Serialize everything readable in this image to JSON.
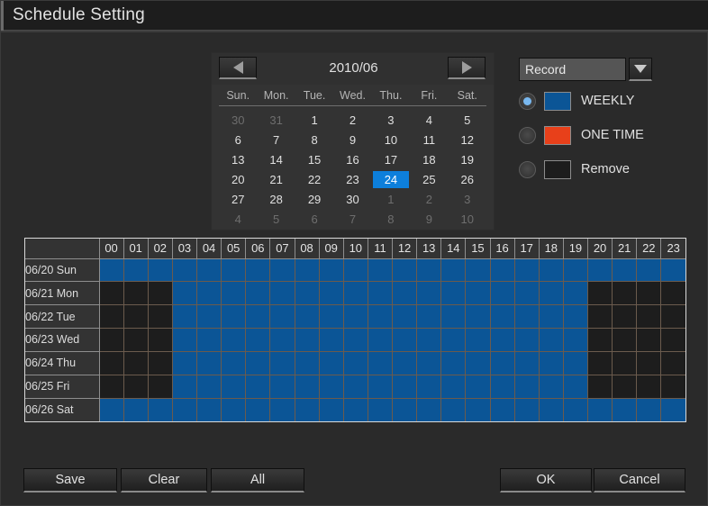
{
  "window": {
    "title": "Schedule Setting"
  },
  "calendar": {
    "prev_icon": "triangle-left-icon",
    "next_icon": "triangle-right-icon",
    "month_label": "2010/06",
    "day_headers": [
      "Sun.",
      "Mon.",
      "Tue.",
      "Wed.",
      "Thu.",
      "Fri.",
      "Sat."
    ],
    "selected_day": 24,
    "weeks": [
      [
        {
          "n": "30",
          "other": true
        },
        {
          "n": "31",
          "other": true
        },
        {
          "n": "1"
        },
        {
          "n": "2"
        },
        {
          "n": "3"
        },
        {
          "n": "4"
        },
        {
          "n": "5"
        }
      ],
      [
        {
          "n": "6"
        },
        {
          "n": "7"
        },
        {
          "n": "8"
        },
        {
          "n": "9"
        },
        {
          "n": "10"
        },
        {
          "n": "11"
        },
        {
          "n": "12"
        }
      ],
      [
        {
          "n": "13"
        },
        {
          "n": "14"
        },
        {
          "n": "15"
        },
        {
          "n": "16"
        },
        {
          "n": "17"
        },
        {
          "n": "18"
        },
        {
          "n": "19"
        }
      ],
      [
        {
          "n": "20"
        },
        {
          "n": "21"
        },
        {
          "n": "22"
        },
        {
          "n": "23"
        },
        {
          "n": "24",
          "selected": true
        },
        {
          "n": "25"
        },
        {
          "n": "26"
        }
      ],
      [
        {
          "n": "27"
        },
        {
          "n": "28"
        },
        {
          "n": "29"
        },
        {
          "n": "30"
        },
        {
          "n": "1",
          "other": true
        },
        {
          "n": "2",
          "other": true
        },
        {
          "n": "3",
          "other": true
        }
      ],
      [
        {
          "n": "4",
          "other": true
        },
        {
          "n": "5",
          "other": true
        },
        {
          "n": "6",
          "other": true
        },
        {
          "n": "7",
          "other": true
        },
        {
          "n": "8",
          "other": true
        },
        {
          "n": "9",
          "other": true
        },
        {
          "n": "10",
          "other": true
        }
      ]
    ]
  },
  "mode_panel": {
    "dropdown": {
      "value": "Record",
      "placeholder": "Record",
      "arrow_icon": "chevron-down-icon",
      "options": [
        "Record"
      ]
    },
    "options": [
      {
        "label": "WEEKLY",
        "color": "#0b5596",
        "selected": true
      },
      {
        "label": "ONE TIME",
        "color": "#e8401a",
        "selected": false
      },
      {
        "label": "Remove",
        "color": "#1d1d1d",
        "selected": false
      }
    ]
  },
  "schedule": {
    "hours": [
      "00",
      "01",
      "02",
      "03",
      "04",
      "05",
      "06",
      "07",
      "08",
      "09",
      "10",
      "11",
      "12",
      "13",
      "14",
      "15",
      "16",
      "17",
      "18",
      "19",
      "20",
      "21",
      "22",
      "23"
    ],
    "rows": [
      {
        "label": "06/20 Sun",
        "slots": [
          "w",
          "w",
          "w",
          "w",
          "w",
          "w",
          "w",
          "w",
          "w",
          "w",
          "w",
          "w",
          "w",
          "w",
          "w",
          "w",
          "w",
          "w",
          "w",
          "w",
          "w",
          "w",
          "w",
          "w"
        ]
      },
      {
        "label": "06/21 Mon",
        "slots": [
          "",
          "",
          "",
          "w",
          "w",
          "w",
          "w",
          "w",
          "w",
          "w",
          "w",
          "w",
          "w",
          "w",
          "w",
          "w",
          "w",
          "w",
          "w",
          "w",
          "",
          "",
          "",
          ""
        ]
      },
      {
        "label": "06/22 Tue",
        "slots": [
          "",
          "",
          "",
          "w",
          "w",
          "w",
          "w",
          "w",
          "w",
          "w",
          "w",
          "w",
          "w",
          "w",
          "w",
          "w",
          "w",
          "w",
          "w",
          "w",
          "",
          "",
          "",
          ""
        ]
      },
      {
        "label": "06/23 Wed",
        "slots": [
          "",
          "",
          "",
          "w",
          "w",
          "w",
          "w",
          "w",
          "w",
          "w",
          "w",
          "w",
          "w",
          "w",
          "w",
          "w",
          "w",
          "w",
          "w",
          "w",
          "",
          "",
          "",
          ""
        ]
      },
      {
        "label": "06/24 Thu",
        "slots": [
          "",
          "",
          "",
          "w",
          "w",
          "w",
          "w",
          "w",
          "w",
          "w",
          "w",
          "w",
          "w",
          "w",
          "w",
          "w",
          "w",
          "w",
          "w",
          "w",
          "",
          "",
          "",
          ""
        ]
      },
      {
        "label": "06/25 Fri",
        "slots": [
          "",
          "",
          "",
          "w",
          "w",
          "w",
          "w",
          "w",
          "w",
          "w",
          "w",
          "w",
          "w",
          "w",
          "w",
          "w",
          "w",
          "w",
          "w",
          "w",
          "",
          "",
          "",
          ""
        ]
      },
      {
        "label": "06/26 Sat",
        "slots": [
          "w",
          "w",
          "w",
          "w",
          "w",
          "w",
          "w",
          "w",
          "w",
          "w",
          "w",
          "w",
          "w",
          "w",
          "w",
          "w",
          "w",
          "w",
          "w",
          "w",
          "w",
          "w",
          "w",
          "w"
        ]
      }
    ]
  },
  "buttons": {
    "save": "Save",
    "clear": "Clear",
    "all": "All",
    "ok": "OK",
    "cancel": "Cancel"
  },
  "colors": {
    "weekly": "#0b5596",
    "one_time": "#e8401a",
    "remove": "#1d1d1d",
    "selection": "#0d7fdb",
    "background": "#2a2a2a"
  }
}
